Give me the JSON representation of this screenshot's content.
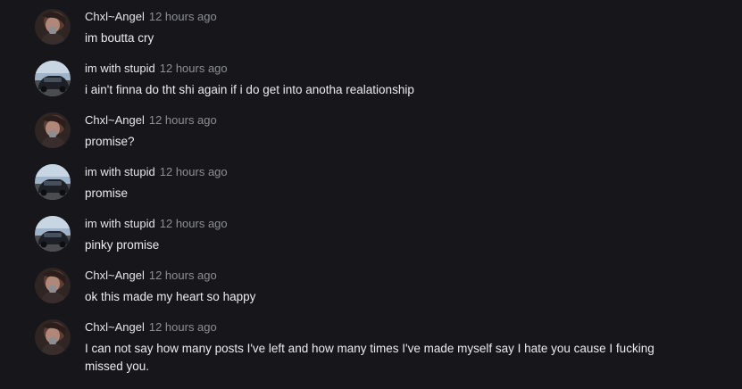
{
  "comments": [
    {
      "author": "Chxl~Angel",
      "time": "12 hours ago",
      "text": "im boutta cry",
      "avatar": "angel-avatar"
    },
    {
      "author": "im with stupid",
      "time": "12 hours ago",
      "text": "i ain't finna do tht shi again if i do get into anotha realationship",
      "avatar": "car-avatar"
    },
    {
      "author": "Chxl~Angel",
      "time": "12 hours ago",
      "text": "promise?",
      "avatar": "angel-avatar"
    },
    {
      "author": "im with stupid",
      "time": "12 hours ago",
      "text": "promise",
      "avatar": "car-avatar"
    },
    {
      "author": "im with stupid",
      "time": "12 hours ago",
      "text": "pinky promise",
      "avatar": "car-avatar"
    },
    {
      "author": "Chxl~Angel",
      "time": "12 hours ago",
      "text": "ok this made my heart so happy",
      "avatar": "angel-avatar"
    },
    {
      "author": "Chxl~Angel",
      "time": "12 hours ago",
      "text": "I can not say how many posts I've left and how many times I've made myself say I hate you cause I fucking missed you.",
      "avatar": "angel-avatar"
    }
  ]
}
